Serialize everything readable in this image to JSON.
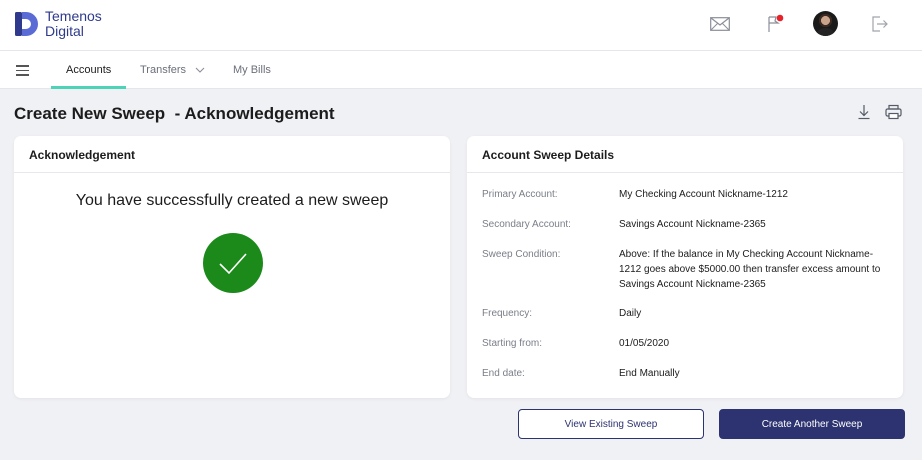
{
  "brand": {
    "name_line1": "Temenos",
    "name_line2": "Digital"
  },
  "header": {
    "icons": [
      "mail-icon",
      "flag-icon",
      "avatar",
      "logout-icon"
    ],
    "notification_color": "#e8212b"
  },
  "nav": {
    "tabs": [
      {
        "label": "Accounts",
        "active": true
      },
      {
        "label": "Transfers",
        "has_dropdown": true
      },
      {
        "label": "My Bills"
      }
    ],
    "accent": "#4cd3b8"
  },
  "page": {
    "title": "Create New Sweep  - Acknowledgement"
  },
  "ack": {
    "title": "Acknowledgement",
    "message": "You have successfully created a new sweep",
    "success_color": "#1b8a1b"
  },
  "details": {
    "title": "Account Sweep Details",
    "rows": [
      {
        "label": "Primary Account:",
        "value": "My Checking Account Nickname-1212"
      },
      {
        "label": "Secondary Account:",
        "value": "Savings Account Nickname-2365"
      },
      {
        "label": "Sweep Condition:",
        "value": "Above: If the balance in My Checking Account Nickname-1212 goes above $5000.00 then transfer excess amount to Savings Account Nickname-2365"
      },
      {
        "label": "Frequency:",
        "value": "Daily"
      },
      {
        "label": "Starting from:",
        "value": "01/05/2020"
      },
      {
        "label": "End date:",
        "value": "End Manually"
      }
    ]
  },
  "actions": {
    "view_label": "View Existing Sweep",
    "create_label": "Create Another Sweep",
    "primary_color": "#2d3370"
  }
}
